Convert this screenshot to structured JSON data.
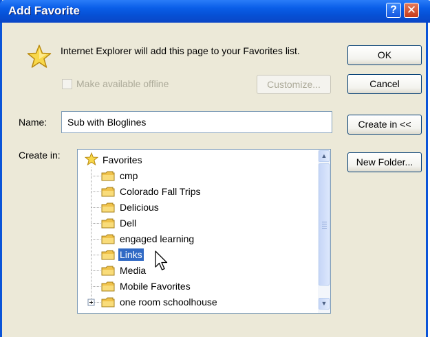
{
  "window": {
    "title": "Add Favorite"
  },
  "titlebar": {
    "help_glyph": "?",
    "close_glyph": "✕"
  },
  "message": "Internet Explorer will add this page to your Favorites list.",
  "offline": {
    "label": "Make available offline",
    "checked": false
  },
  "buttons": {
    "ok": "OK",
    "cancel": "Cancel",
    "customize": "Customize...",
    "create_in": "Create in <<",
    "new_folder": "New Folder..."
  },
  "name_field": {
    "label": "Name:",
    "value": "Sub with Bloglines"
  },
  "create_in_label": "Create in:",
  "tree": {
    "root": "Favorites",
    "items": [
      {
        "label": "cmp",
        "selected": false,
        "expandable": false
      },
      {
        "label": "Colorado Fall Trips",
        "selected": false,
        "expandable": false
      },
      {
        "label": "Delicious",
        "selected": false,
        "expandable": false
      },
      {
        "label": "Dell",
        "selected": false,
        "expandable": false
      },
      {
        "label": "engaged learning",
        "selected": false,
        "expandable": false
      },
      {
        "label": "Links",
        "selected": true,
        "expandable": false
      },
      {
        "label": "Media",
        "selected": false,
        "expandable": false
      },
      {
        "label": "Mobile Favorites",
        "selected": false,
        "expandable": false
      },
      {
        "label": "one room schoolhouse",
        "selected": false,
        "expandable": true
      }
    ]
  },
  "icons": {
    "star": "star-icon",
    "folder": "folder-icon",
    "cursor": "mouse-pointer-icon"
  },
  "colors": {
    "titlebar": "#0a5ee8",
    "selection": "#316ac5",
    "dialog_bg": "#ece9d8"
  }
}
